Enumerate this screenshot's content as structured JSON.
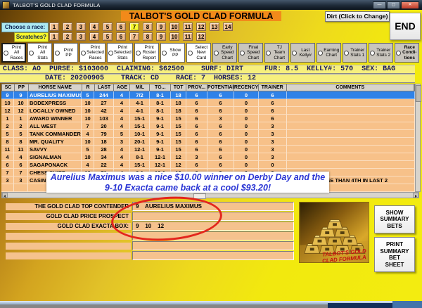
{
  "window": {
    "title": "TALBOT'S GOLD CLAD FORMULA",
    "controls": {
      "minimize": "—",
      "maximize": "▢",
      "close": "✕"
    }
  },
  "header": {
    "app_title": "TALBOT'S GOLD CLAD FORMULA",
    "surface_button_label": "Dirt (Click to Change)",
    "end_button_label": "END"
  },
  "race_chooser": {
    "label": "Choose  a race:",
    "buttons": [
      "1",
      "2",
      "3",
      "4",
      "5",
      "6",
      "7",
      "8",
      "9",
      "10",
      "11",
      "12",
      "13",
      "14"
    ],
    "selected": "7"
  },
  "scratches": {
    "label": "Scratches?",
    "buttons": [
      "1",
      "2",
      "3",
      "4",
      "5",
      "6",
      "7",
      "8",
      "9",
      "10",
      "11",
      "12"
    ]
  },
  "print_options": [
    {
      "label": "Print\nAll\nRaces",
      "variant": "white"
    },
    {
      "label": "Print\nAll\nStats",
      "variant": "white"
    },
    {
      "label": "Print\nPP",
      "variant": "white"
    },
    {
      "label": "Print\nSelected\nRaces",
      "variant": "white"
    },
    {
      "label": "Print\nSelected\nStats",
      "variant": "white"
    },
    {
      "label": "Print\nRoster\nReport",
      "variant": "white"
    },
    {
      "label": "Show\nPP",
      "variant": "white"
    },
    {
      "label": "Select\nNew\nCard",
      "variant": "white"
    },
    {
      "label": "Early\nSpeed\nChart",
      "variant": "gray"
    },
    {
      "label": "Final\nSpeed\nChart",
      "variant": "gray"
    },
    {
      "label": "TJ\nTeam\nChart",
      "variant": "gray"
    },
    {
      "label": "Last\nKelly#",
      "variant": "gray"
    },
    {
      "label": "Earning\nChart",
      "variant": "gray"
    },
    {
      "label": "Trainer\nStats 1",
      "variant": "gray"
    },
    {
      "label": "Trainer\nStats 2",
      "variant": "gray"
    },
    {
      "label": "Race\nCondi-\ntions",
      "variant": "gray-bold"
    }
  ],
  "race_info": {
    "line1": "CLASS: AO  PURSE: $103000  CLAIMING: $62500    SURF: DIRT     FUR: 8.5  KELLY#: 570  SEX: BAG",
    "line2": "          DATE: 20200905    TRACK: CD    RACE: 7  HORSES: 12"
  },
  "table": {
    "columns": [
      "SC",
      "PP",
      "HORSE NAME",
      "R",
      "LAST",
      "AGE",
      "M/L",
      "TG...",
      "TOT",
      "PROV...",
      "POTENTIAL",
      "RECENCY",
      "TRAINER",
      "COMMENTS"
    ],
    "selected_row_index": 0,
    "rows": [
      [
        "9",
        "9",
        "AURELIUS MAXIMUS...",
        "5",
        "244",
        "4",
        "7/2",
        "8-1",
        "18",
        "6",
        "6",
        "0",
        "6",
        ""
      ],
      [
        "10",
        "10",
        "BODEXPRESS",
        "10",
        "27",
        "4",
        "4-1",
        "8-1",
        "18",
        "6",
        "6",
        "0",
        "6",
        ""
      ],
      [
        "12",
        "12",
        "LOCALLY OWNED",
        "10",
        "42",
        "4",
        "4-1",
        "8-1",
        "18",
        "6",
        "6",
        "0",
        "6",
        ""
      ],
      [
        "1",
        "1",
        "AWARD WINNER",
        "10",
        "103",
        "4",
        "15-1",
        "9-1",
        "15",
        "6",
        "3",
        "0",
        "6",
        ""
      ],
      [
        "2",
        "2",
        "ALL WEST",
        "7",
        "20",
        "4",
        "15-1",
        "9-1",
        "15",
        "6",
        "6",
        "0",
        "3",
        ""
      ],
      [
        "5",
        "5",
        "TANK COMMANDER ...",
        "4",
        "79",
        "5",
        "10-1",
        "9-1",
        "15",
        "6",
        "6",
        "0",
        "3",
        ""
      ],
      [
        "8",
        "8",
        "MR. QUALITY",
        "10",
        "18",
        "3",
        "20-1",
        "9-1",
        "15",
        "6",
        "6",
        "0",
        "3",
        ""
      ],
      [
        "11",
        "11",
        "SAVVY",
        "5",
        "28",
        "4",
        "12-1",
        "9-1",
        "15",
        "6",
        "6",
        "0",
        "3",
        ""
      ],
      [
        "4",
        "4",
        "SIGNALMAN",
        "10",
        "34",
        "4",
        "8-1",
        "12-1",
        "12",
        "3",
        "6",
        "0",
        "3",
        ""
      ],
      [
        "6",
        "6",
        "SAGAPONACK",
        "4",
        "22",
        "4",
        "15-1",
        "12-1",
        "12",
        "6",
        "6",
        "0",
        "0",
        ""
      ],
      [
        "7",
        "7",
        "CHESS CHIEF",
        "10",
        "71",
        "4",
        "6-1",
        "12-1",
        "12",
        "6",
        "3",
        "0",
        "3",
        ""
      ],
      [
        "3",
        "3",
        "CASIN",
        "",
        "",
        "",
        "",
        "",
        "",
        "",
        "",
        "",
        "",
        "WORSE THAN 4TH IN LAST 2"
      ]
    ]
  },
  "promo_overlay": {
    "line1": "Aurelius Maximus was a nice $10.00 winner on Derby Day and the",
    "line2": "9-10 Exacta came back at a cool $93.20!"
  },
  "summary": {
    "rows": [
      {
        "label": "THE GOLD CLAD TOP CONTENDER",
        "value": "9    AURELIUS MAXIMUS"
      },
      {
        "label": "GOLD CLAD PRICE PROSPECT",
        "value": ""
      },
      {
        "label": "GOLD CLAD EXACTA BOX:",
        "value": "9    10    12"
      },
      {
        "label": "",
        "value": ""
      },
      {
        "label": "",
        "value": ""
      },
      {
        "label": "",
        "value": ""
      }
    ],
    "show_button": "SHOW\nSUMMARY\nBETS",
    "print_button": "PRINT\nSUMMARY\nBET\nSHEET"
  },
  "gold_image_caption": {
    "line1": "TALBOT'S GOLD",
    "line2": "CLAD FORMULA"
  },
  "colors": {
    "banner_orange": "#F28A1A",
    "row_peach": "#F7C189",
    "selected_blue": "#2F82E8",
    "highlight_yellow": "#F8F832",
    "promo_blue": "#2A35D4",
    "circle_red": "#E3261D"
  }
}
